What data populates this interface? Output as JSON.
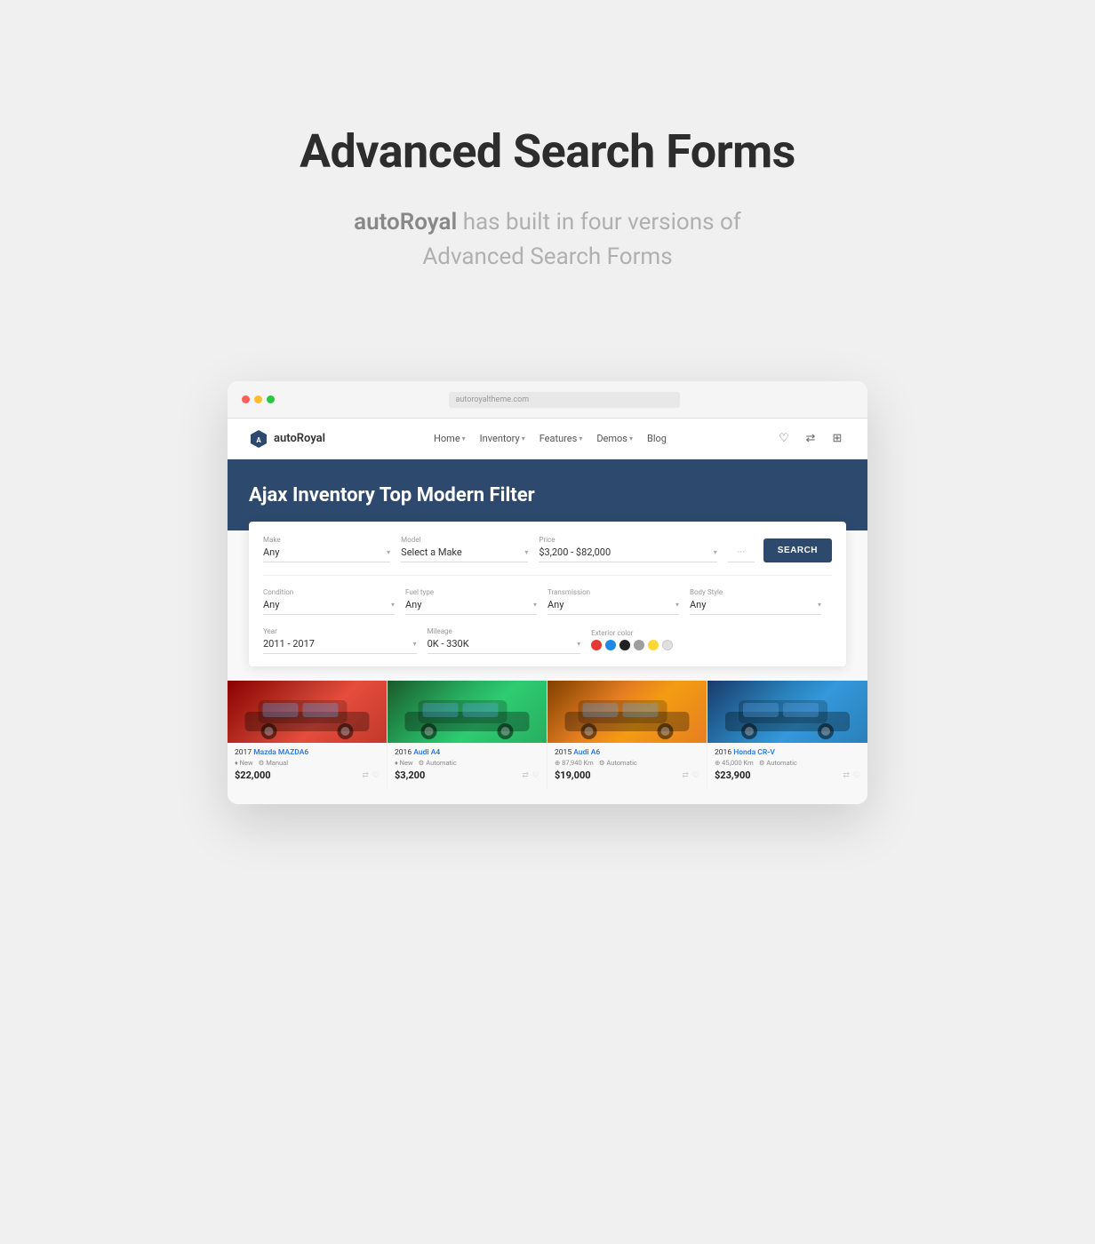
{
  "page": {
    "background": "#f0f0f0"
  },
  "hero": {
    "title": "Advanced Search Forms",
    "subtitle_brand": "autoRoyal",
    "subtitle_rest": " has built in four versions of Advanced Search Forms"
  },
  "browser": {
    "navbar": {
      "brand_name": "autoRoyal",
      "nav_items": [
        {
          "label": "Home",
          "has_chevron": true
        },
        {
          "label": "Inventory",
          "has_chevron": true
        },
        {
          "label": "Features",
          "has_chevron": true
        },
        {
          "label": "Demos",
          "has_chevron": true
        },
        {
          "label": "Blog",
          "has_chevron": false
        }
      ]
    },
    "banner": {
      "title": "Ajax Inventory Top Modern Filter"
    },
    "search_form": {
      "row1": {
        "make_label": "Make",
        "make_value": "Any",
        "model_label": "Model",
        "model_value": "Select a Make",
        "price_label": "Price",
        "price_value": "$3,200 - $82,000",
        "search_button": "SEARCH"
      },
      "row2": {
        "condition_label": "Condition",
        "condition_value": "Any",
        "fuel_label": "Fuel type",
        "fuel_value": "Any",
        "transmission_label": "Transmission",
        "transmission_value": "Any",
        "body_label": "Body Style",
        "body_value": "Any"
      },
      "row3": {
        "year_label": "Year",
        "year_value": "2011 - 2017",
        "mileage_label": "Mileage",
        "mileage_value": "0K - 330K",
        "exterior_label": "Exterior color",
        "colors": [
          {
            "name": "red",
            "hex": "#e53935"
          },
          {
            "name": "blue",
            "hex": "#1e88e5"
          },
          {
            "name": "black",
            "hex": "#212121"
          },
          {
            "name": "gray",
            "hex": "#9e9e9e"
          },
          {
            "name": "yellow",
            "hex": "#fdd835"
          },
          {
            "name": "lightgray",
            "hex": "#e0e0e0"
          }
        ]
      }
    },
    "cars": [
      {
        "year": "2017",
        "make": "Mazda",
        "model": "MAZDA6",
        "condition": "New",
        "transmission": "Manual",
        "mileage": null,
        "price": "$22,000",
        "image_bg": "#c0392b",
        "image_label": "🚗"
      },
      {
        "year": "2016",
        "make": "Audi",
        "model": "A4",
        "condition": "New",
        "transmission": "Automatic",
        "mileage": null,
        "price": "$3,200",
        "image_bg": "#27ae60",
        "image_label": "🚗"
      },
      {
        "year": "2015",
        "make": "Audi",
        "model": "A6",
        "condition": null,
        "transmission": "Automatic",
        "mileage": "87,940 Km",
        "price": "$19,000",
        "image_bg": "#e67e22",
        "image_label": "🚗"
      },
      {
        "year": "2016",
        "make": "Honda",
        "model": "CR-V",
        "condition": null,
        "transmission": "Automatic",
        "mileage": "45,000 Km",
        "price": "$23,900",
        "image_bg": "#2980b9",
        "image_label": "🚗"
      }
    ]
  }
}
